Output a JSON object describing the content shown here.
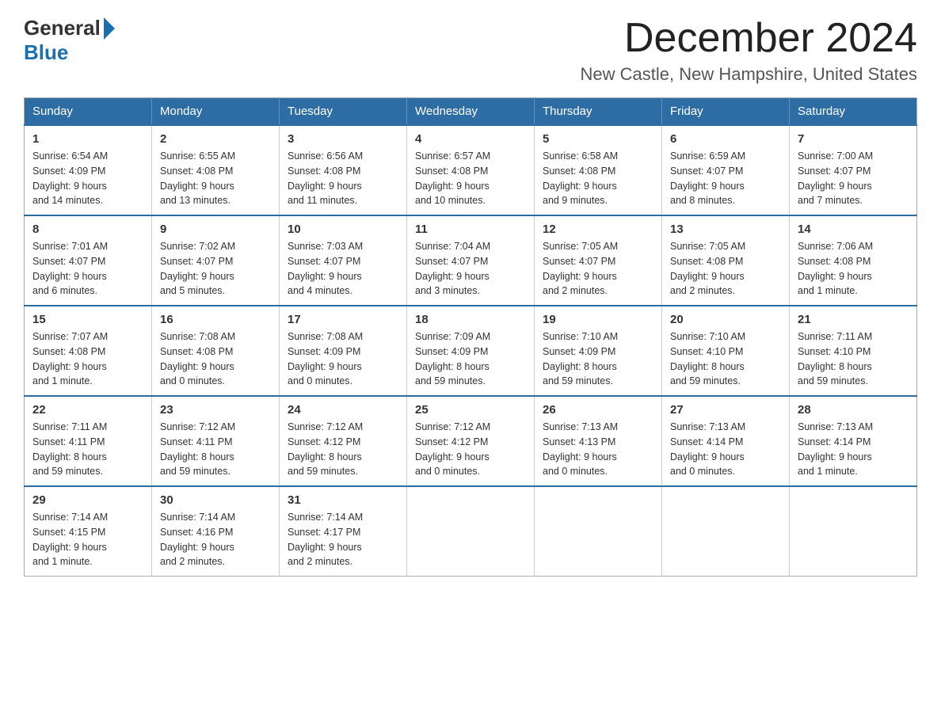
{
  "header": {
    "logo_general": "General",
    "logo_blue": "Blue",
    "month_title": "December 2024",
    "location": "New Castle, New Hampshire, United States"
  },
  "days_of_week": [
    "Sunday",
    "Monday",
    "Tuesday",
    "Wednesday",
    "Thursday",
    "Friday",
    "Saturday"
  ],
  "weeks": [
    [
      {
        "day": "1",
        "info": "Sunrise: 6:54 AM\nSunset: 4:09 PM\nDaylight: 9 hours\nand 14 minutes."
      },
      {
        "day": "2",
        "info": "Sunrise: 6:55 AM\nSunset: 4:08 PM\nDaylight: 9 hours\nand 13 minutes."
      },
      {
        "day": "3",
        "info": "Sunrise: 6:56 AM\nSunset: 4:08 PM\nDaylight: 9 hours\nand 11 minutes."
      },
      {
        "day": "4",
        "info": "Sunrise: 6:57 AM\nSunset: 4:08 PM\nDaylight: 9 hours\nand 10 minutes."
      },
      {
        "day": "5",
        "info": "Sunrise: 6:58 AM\nSunset: 4:08 PM\nDaylight: 9 hours\nand 9 minutes."
      },
      {
        "day": "6",
        "info": "Sunrise: 6:59 AM\nSunset: 4:07 PM\nDaylight: 9 hours\nand 8 minutes."
      },
      {
        "day": "7",
        "info": "Sunrise: 7:00 AM\nSunset: 4:07 PM\nDaylight: 9 hours\nand 7 minutes."
      }
    ],
    [
      {
        "day": "8",
        "info": "Sunrise: 7:01 AM\nSunset: 4:07 PM\nDaylight: 9 hours\nand 6 minutes."
      },
      {
        "day": "9",
        "info": "Sunrise: 7:02 AM\nSunset: 4:07 PM\nDaylight: 9 hours\nand 5 minutes."
      },
      {
        "day": "10",
        "info": "Sunrise: 7:03 AM\nSunset: 4:07 PM\nDaylight: 9 hours\nand 4 minutes."
      },
      {
        "day": "11",
        "info": "Sunrise: 7:04 AM\nSunset: 4:07 PM\nDaylight: 9 hours\nand 3 minutes."
      },
      {
        "day": "12",
        "info": "Sunrise: 7:05 AM\nSunset: 4:07 PM\nDaylight: 9 hours\nand 2 minutes."
      },
      {
        "day": "13",
        "info": "Sunrise: 7:05 AM\nSunset: 4:08 PM\nDaylight: 9 hours\nand 2 minutes."
      },
      {
        "day": "14",
        "info": "Sunrise: 7:06 AM\nSunset: 4:08 PM\nDaylight: 9 hours\nand 1 minute."
      }
    ],
    [
      {
        "day": "15",
        "info": "Sunrise: 7:07 AM\nSunset: 4:08 PM\nDaylight: 9 hours\nand 1 minute."
      },
      {
        "day": "16",
        "info": "Sunrise: 7:08 AM\nSunset: 4:08 PM\nDaylight: 9 hours\nand 0 minutes."
      },
      {
        "day": "17",
        "info": "Sunrise: 7:08 AM\nSunset: 4:09 PM\nDaylight: 9 hours\nand 0 minutes."
      },
      {
        "day": "18",
        "info": "Sunrise: 7:09 AM\nSunset: 4:09 PM\nDaylight: 8 hours\nand 59 minutes."
      },
      {
        "day": "19",
        "info": "Sunrise: 7:10 AM\nSunset: 4:09 PM\nDaylight: 8 hours\nand 59 minutes."
      },
      {
        "day": "20",
        "info": "Sunrise: 7:10 AM\nSunset: 4:10 PM\nDaylight: 8 hours\nand 59 minutes."
      },
      {
        "day": "21",
        "info": "Sunrise: 7:11 AM\nSunset: 4:10 PM\nDaylight: 8 hours\nand 59 minutes."
      }
    ],
    [
      {
        "day": "22",
        "info": "Sunrise: 7:11 AM\nSunset: 4:11 PM\nDaylight: 8 hours\nand 59 minutes."
      },
      {
        "day": "23",
        "info": "Sunrise: 7:12 AM\nSunset: 4:11 PM\nDaylight: 8 hours\nand 59 minutes."
      },
      {
        "day": "24",
        "info": "Sunrise: 7:12 AM\nSunset: 4:12 PM\nDaylight: 8 hours\nand 59 minutes."
      },
      {
        "day": "25",
        "info": "Sunrise: 7:12 AM\nSunset: 4:12 PM\nDaylight: 9 hours\nand 0 minutes."
      },
      {
        "day": "26",
        "info": "Sunrise: 7:13 AM\nSunset: 4:13 PM\nDaylight: 9 hours\nand 0 minutes."
      },
      {
        "day": "27",
        "info": "Sunrise: 7:13 AM\nSunset: 4:14 PM\nDaylight: 9 hours\nand 0 minutes."
      },
      {
        "day": "28",
        "info": "Sunrise: 7:13 AM\nSunset: 4:14 PM\nDaylight: 9 hours\nand 1 minute."
      }
    ],
    [
      {
        "day": "29",
        "info": "Sunrise: 7:14 AM\nSunset: 4:15 PM\nDaylight: 9 hours\nand 1 minute."
      },
      {
        "day": "30",
        "info": "Sunrise: 7:14 AM\nSunset: 4:16 PM\nDaylight: 9 hours\nand 2 minutes."
      },
      {
        "day": "31",
        "info": "Sunrise: 7:14 AM\nSunset: 4:17 PM\nDaylight: 9 hours\nand 2 minutes."
      },
      {
        "day": "",
        "info": ""
      },
      {
        "day": "",
        "info": ""
      },
      {
        "day": "",
        "info": ""
      },
      {
        "day": "",
        "info": ""
      }
    ]
  ]
}
